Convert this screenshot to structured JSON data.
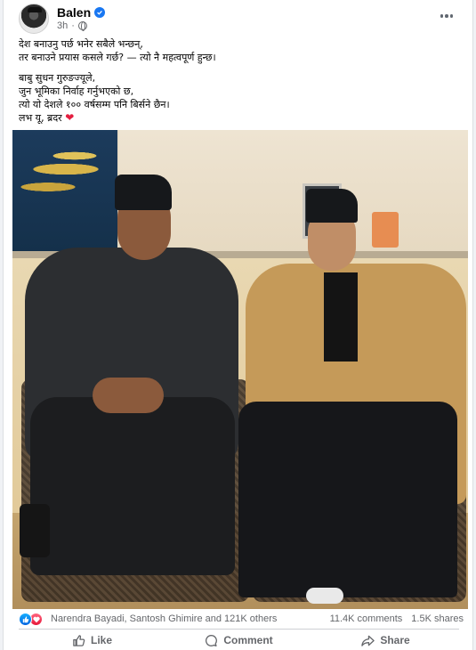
{
  "post": {
    "author": "Balen",
    "time": "3h",
    "text_lines_1": [
      "देश बनाउनु पर्छ भनेर सबैले भन्छन्,",
      "तर बनाउने प्रयास कसले गर्छ? — त्यो नै महत्वपूर्ण हुन्छ।"
    ],
    "text_lines_2": [
      "बाबु सुधन गुरुङज्यूले,",
      "जुन भूमिका निर्वाह गर्नुभएको छ,",
      "त्यो यो देशले १०० वर्षसम्म पनि बिर्सने छैन।",
      "लभ यू, ब्रदर"
    ]
  },
  "reactions": {
    "reactors": "Narendra Bayadi, Santosh Ghimire and 121K others",
    "comments": "11.4K comments",
    "shares": "1.5K shares",
    "icons": [
      "like-icon",
      "love-icon"
    ]
  },
  "actions": {
    "like": "Like",
    "comment": "Comment",
    "share": "Share"
  },
  "colors": {
    "brand_blue": "#1877f2",
    "secondary_text": "#65676b",
    "love_red": "#e41e3f"
  }
}
